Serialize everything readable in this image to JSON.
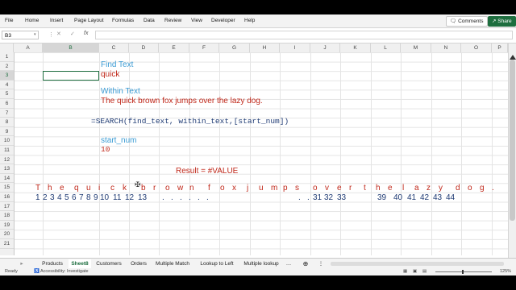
{
  "ribbon": {
    "tabs": [
      "File",
      "Home",
      "Insert",
      "Page Layout",
      "Formulas",
      "Data",
      "Review",
      "View",
      "Developer",
      "Help"
    ],
    "comments_label": "Comments",
    "share_label": "Share"
  },
  "formula_bar": {
    "name_box": "B3",
    "fx_symbol": "fx",
    "formula": ""
  },
  "columns": [
    "A",
    "B",
    "C",
    "D",
    "E",
    "F",
    "G",
    "H",
    "I",
    "J",
    "K",
    "L",
    "M",
    "N",
    "O",
    "P"
  ],
  "rows": [
    "1",
    "2",
    "3",
    "4",
    "5",
    "6",
    "7",
    "8",
    "9",
    "10",
    "11",
    "12",
    "13",
    "14",
    "15",
    "16",
    "17",
    "18",
    "19",
    "20",
    "21"
  ],
  "cells": {
    "find_text_label": "Find Text",
    "find_text_value": "quick",
    "within_text_label": "Within Text",
    "within_text_value": "The quick brown fox jumps over the lazy dog.",
    "syntax": "=SEARCH(find_text, within_text,[start_num])",
    "start_num_label": "start_num",
    "start_num_value": "10",
    "result": "Result = #VALUE"
  },
  "row15_chars": [
    "T",
    "h",
    "e",
    "q",
    "u",
    "i",
    "c",
    "k",
    "b",
    "r",
    "o",
    "w",
    "n",
    "f",
    "o",
    "x",
    "j",
    "u",
    "m",
    "p",
    "s",
    "o",
    "v",
    "e",
    "r",
    "t",
    "h",
    "e",
    "l",
    "a",
    "z",
    "y",
    "d",
    "o",
    "g",
    "."
  ],
  "row16_numbers": [
    "1",
    "2",
    "3",
    "4",
    "5",
    "6",
    "7",
    "8",
    "9",
    "10",
    "11",
    "12",
    "13",
    ".",
    ".",
    ".",
    ".",
    ".",
    ".",
    ".",
    ".",
    "31",
    "32",
    "33",
    "39",
    "40",
    "41",
    "42",
    "43",
    "44"
  ],
  "sheet_tabs": [
    "Products",
    "Sheet8",
    "Customers",
    "Orders",
    "Multiple Match",
    "Lookup to Left",
    "Multiple lookup"
  ],
  "active_sheet": "Sheet8",
  "status": {
    "ready": "Ready",
    "accessibility": "Accessibility: Investigate",
    "zoom": "125%"
  },
  "colors": {
    "accent": "#1e6e3f",
    "label_blue": "#3a9bd4",
    "value_red": "#c0281a",
    "formula_navy": "#1f3b74"
  }
}
